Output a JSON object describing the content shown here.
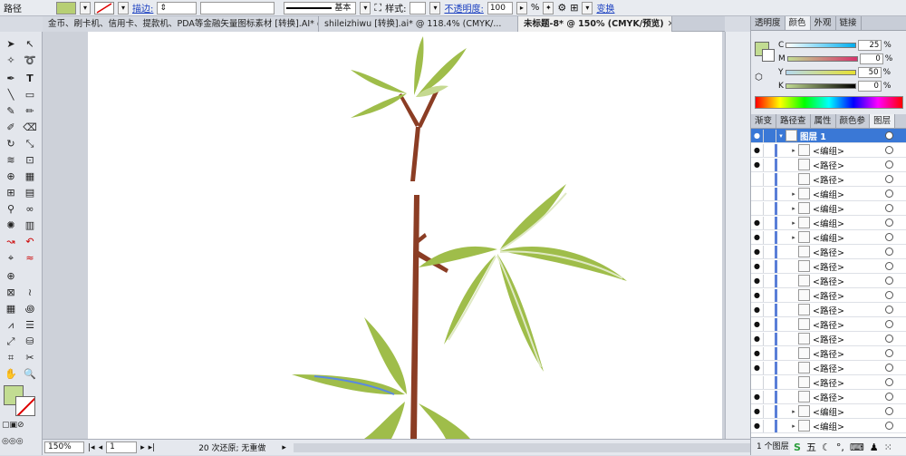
{
  "control_bar": {
    "object_type": "路径",
    "stroke_label": "描边:",
    "stroke_style": "基本",
    "style_label": "样式:",
    "opacity_label": "不透明度:",
    "opacity_value": "100",
    "opacity_unit": "%",
    "transform_label": "变换",
    "fill_color": "#b7cf74"
  },
  "doc_tabs": [
    {
      "label": "金币、刷卡机、信用卡、提款机、PDA等金融矢量图标素材 [转换].AI* @ ...",
      "active": false
    },
    {
      "label": "shileizhiwu [转换].ai* @ 118.4% (CMYK/...",
      "active": false
    },
    {
      "label": "未标题-8* @ 150% (CMYK/预览)",
      "active": true
    }
  ],
  "status_bar": {
    "zoom": "150%",
    "page": "1",
    "message": "20 次还原; 无重做"
  },
  "color_panel": {
    "tabs": [
      "透明度",
      "颜色",
      "外观",
      "链接"
    ],
    "active_tab": "颜色",
    "channels": [
      {
        "name": "C",
        "value": "25"
      },
      {
        "name": "M",
        "value": "0"
      },
      {
        "name": "Y",
        "value": "50"
      },
      {
        "name": "K",
        "value": "0"
      }
    ],
    "fill_color": "#c2dc92"
  },
  "layers_panel": {
    "tabs": [
      "渐变",
      "路径查",
      "属性",
      "颜色参",
      "图层"
    ],
    "active_tab": "图层",
    "layer_name": "图层 1",
    "items": [
      {
        "label": "<编组>",
        "visible": true,
        "expand": true
      },
      {
        "label": "<路径>",
        "visible": true,
        "expand": false
      },
      {
        "label": "<路径>",
        "visible": false,
        "expand": false
      },
      {
        "label": "<编组>",
        "visible": false,
        "expand": true
      },
      {
        "label": "<编组>",
        "visible": false,
        "expand": true
      },
      {
        "label": "<编组>",
        "visible": true,
        "expand": true
      },
      {
        "label": "<编组>",
        "visible": true,
        "expand": true
      },
      {
        "label": "<路径>",
        "visible": true,
        "expand": false
      },
      {
        "label": "<路径>",
        "visible": true,
        "expand": false
      },
      {
        "label": "<路径>",
        "visible": true,
        "expand": false
      },
      {
        "label": "<路径>",
        "visible": true,
        "expand": false
      },
      {
        "label": "<路径>",
        "visible": true,
        "expand": false
      },
      {
        "label": "<路径>",
        "visible": true,
        "expand": false
      },
      {
        "label": "<路径>",
        "visible": true,
        "expand": false
      },
      {
        "label": "<路径>",
        "visible": true,
        "expand": false
      },
      {
        "label": "<路径>",
        "visible": true,
        "expand": false
      },
      {
        "label": "<路径>",
        "visible": false,
        "expand": false
      },
      {
        "label": "<路径>",
        "visible": true,
        "expand": false
      },
      {
        "label": "<编组>",
        "visible": true,
        "expand": true
      },
      {
        "label": "<编组>",
        "visible": true,
        "expand": true
      }
    ],
    "footer": "1 个图层"
  },
  "taskbar": {
    "ime": "五"
  }
}
